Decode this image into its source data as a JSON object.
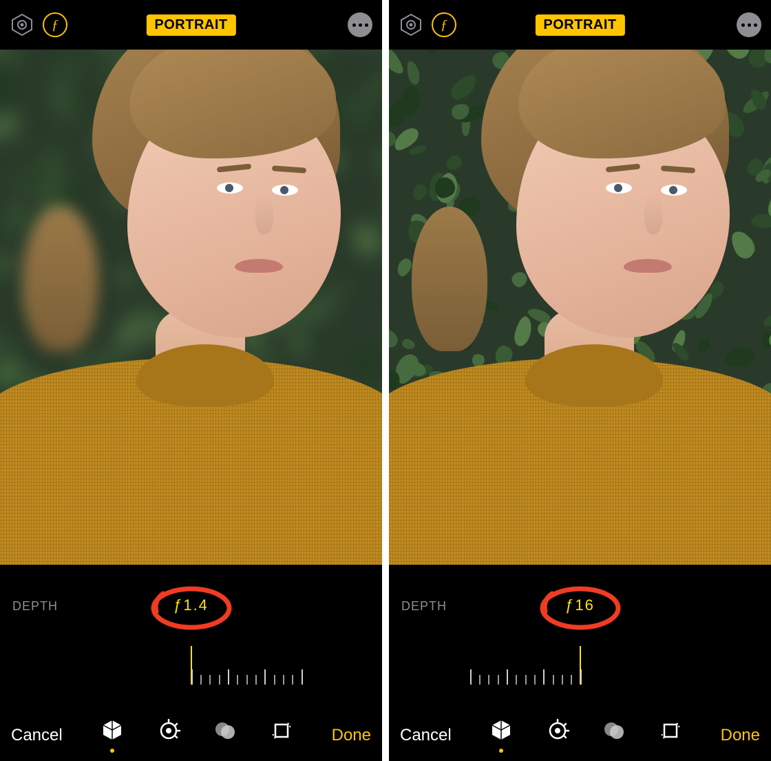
{
  "panes": [
    {
      "header": {
        "mode_badge": "PORTRAIT",
        "f_icon_glyph": "ƒ"
      },
      "depth": {
        "label": "DEPTH",
        "value_prefix": "ƒ",
        "value": "1.4",
        "annotation_color": "#ef3c23",
        "slider_side": "left"
      },
      "footer": {
        "cancel": "Cancel",
        "done": "Done",
        "active_tool_index": 0
      },
      "blur_background": true
    },
    {
      "header": {
        "mode_badge": "PORTRAIT",
        "f_icon_glyph": "ƒ"
      },
      "depth": {
        "label": "DEPTH",
        "value_prefix": "ƒ",
        "value": "16",
        "annotation_color": "#ef3c23",
        "slider_side": "right"
      },
      "footer": {
        "cancel": "Cancel",
        "done": "Done",
        "active_tool_index": 0
      },
      "blur_background": false
    }
  ],
  "tools": [
    {
      "name": "lighting-cube-icon"
    },
    {
      "name": "adjust-dial-icon"
    },
    {
      "name": "filters-circles-icon"
    },
    {
      "name": "crop-rotate-icon"
    }
  ]
}
